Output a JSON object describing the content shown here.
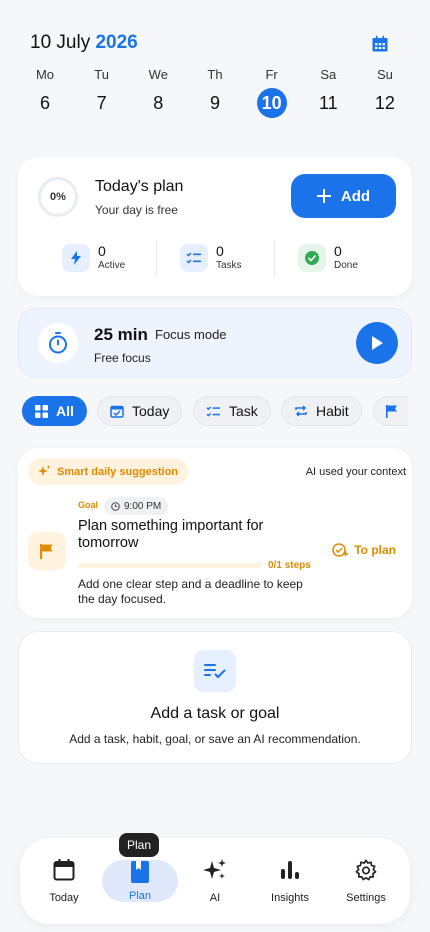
{
  "header": {
    "date_prefix": "10 July",
    "year": "2026"
  },
  "week": [
    {
      "name": "Mo",
      "num": "6"
    },
    {
      "name": "Tu",
      "num": "7"
    },
    {
      "name": "We",
      "num": "8"
    },
    {
      "name": "Th",
      "num": "9"
    },
    {
      "name": "Fr",
      "num": "10"
    },
    {
      "name": "Sa",
      "num": "11"
    },
    {
      "name": "Su",
      "num": "12"
    }
  ],
  "plan": {
    "progress": "0%",
    "title": "Today's plan",
    "subtitle": "Your day is free",
    "add_label": "Add",
    "stats": [
      {
        "count": "0",
        "label": "Active"
      },
      {
        "count": "0",
        "label": "Tasks"
      },
      {
        "count": "0",
        "label": "Done"
      }
    ]
  },
  "focus": {
    "minutes": "25 min",
    "mode": "Focus mode",
    "subtitle": "Free focus"
  },
  "chips": [
    "All",
    "Today",
    "Task",
    "Habit"
  ],
  "suggestion": {
    "badge": "Smart daily suggestion",
    "context": "AI used your context",
    "tag": "Goal",
    "time": "9:00 PM",
    "title": "Plan something important for tomorrow",
    "steps": "0/1 steps",
    "progress_fraction": 0,
    "description": "Add one clear step and a deadline to keep the day focused.",
    "action": "To plan"
  },
  "empty": {
    "title": "Add a task or goal",
    "subtitle": "Add a task, habit, goal, or save an AI recommendation."
  },
  "tooltip": "Plan",
  "nav": [
    {
      "label": "Today"
    },
    {
      "label": "Plan"
    },
    {
      "label": "AI"
    },
    {
      "label": "Insights"
    },
    {
      "label": "Settings"
    }
  ],
  "colors": {
    "accent": "#1a73e8",
    "warning": "#e08a00",
    "success": "#34a853"
  }
}
